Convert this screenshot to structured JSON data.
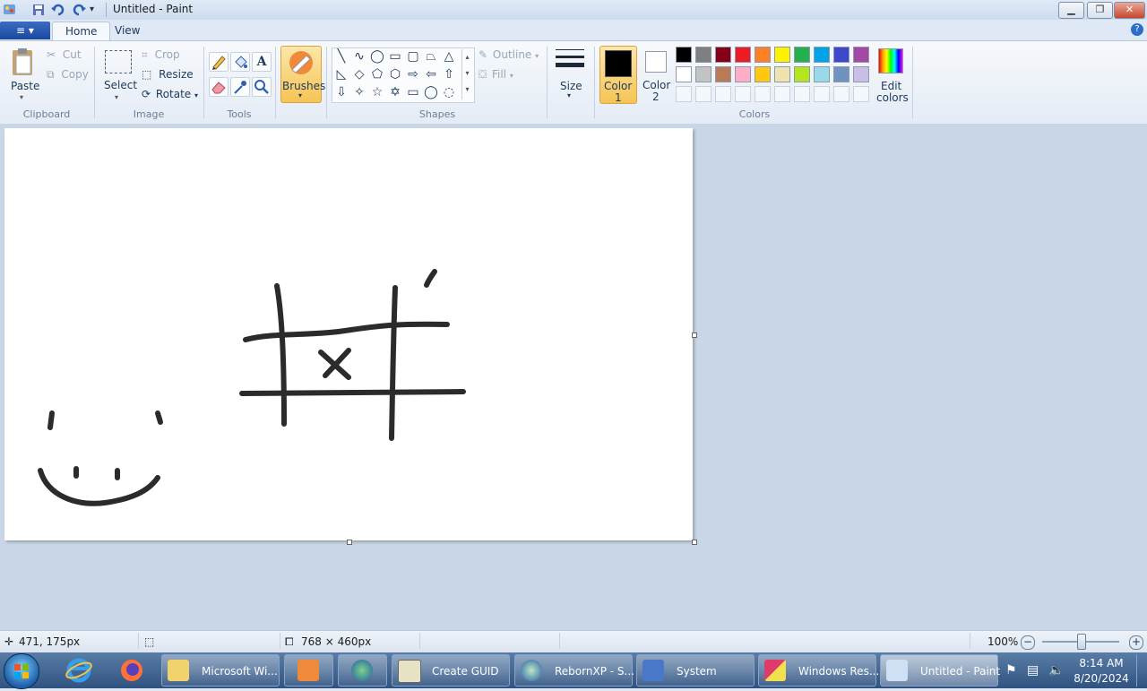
{
  "window": {
    "title": "Untitled - Paint",
    "min": "▁",
    "max": "❐",
    "close": "✕"
  },
  "menu": {
    "file": "≡ ▾"
  },
  "tabs": [
    {
      "label": "Home"
    },
    {
      "label": "View"
    }
  ],
  "ribbon": {
    "clipboard": {
      "paste": "Paste",
      "cut": "Cut",
      "copy": "Copy",
      "group": "Clipboard"
    },
    "image": {
      "select": "Select",
      "crop": "Crop",
      "resize": "Resize",
      "rotate": "Rotate",
      "group": "Image"
    },
    "tools": {
      "group": "Tools"
    },
    "brushes": {
      "label": "Brushes"
    },
    "shapes": {
      "outline": "Outline",
      "fill": "Fill",
      "group": "Shapes"
    },
    "size": {
      "label": "Size"
    },
    "color1": {
      "line1": "Color",
      "line2": "1",
      "value": "#000000"
    },
    "color2": {
      "line1": "Color",
      "line2": "2",
      "value": "#ffffff"
    },
    "colors": {
      "group": "Colors",
      "edit_line1": "Edit",
      "edit_line2": "colors",
      "row1": [
        "#000000",
        "#7f7f7f",
        "#880015",
        "#ed1c24",
        "#ff7f27",
        "#fff200",
        "#22b14c",
        "#00a2e8",
        "#3f48cc",
        "#a349a4"
      ],
      "row2": [
        "#ffffff",
        "#c3c3c3",
        "#b97a57",
        "#ffaec9",
        "#ffc90e",
        "#efe4b0",
        "#b5e61d",
        "#99d9ea",
        "#7092be",
        "#c8bfe7"
      ]
    }
  },
  "status": {
    "cursor_pos": "471, 175px",
    "canvas_size": "768 × 460px",
    "zoom": "100%",
    "zoom_level": 0.5
  },
  "taskbar": {
    "items": [
      {
        "label": "Microsoft Wi..."
      },
      {
        "label": "Create GUID"
      },
      {
        "label": "RebornXP - S..."
      },
      {
        "label": "System"
      },
      {
        "label": "Windows Res..."
      },
      {
        "label": "Untitled - Paint"
      }
    ],
    "time": "8:14 AM",
    "date": "8/20/2024"
  }
}
